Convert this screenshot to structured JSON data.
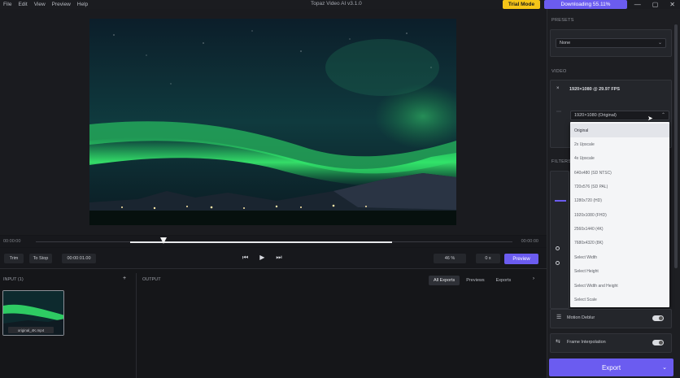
{
  "menu": {
    "items": [
      "File",
      "Edit",
      "View",
      "Preview",
      "Help"
    ]
  },
  "app_title": "Topaz Video AI v3.1.0",
  "trial_label": "Trial Mode",
  "download_label": "Downloading 55.11%",
  "window_controls": {
    "minimize": "—",
    "maximize": "▢",
    "close": "✕"
  },
  "timeline": {
    "start": "00:00:00",
    "end": "00:00:00",
    "progress_fill": 0.55
  },
  "controls": {
    "trim_label": "Trim",
    "step_label": "To Stop",
    "timecode": "00:00:01.00",
    "zoom_value": "46 %",
    "frame_value": "0 x",
    "preview_label": "Preview"
  },
  "input": {
    "label": "INPUT (1)",
    "add": "+",
    "file_name": "original_4K.mp4"
  },
  "output": {
    "label": "OUTPUT",
    "tabs": [
      "All Exports",
      "Previews",
      "Exports"
    ],
    "arrow": "›"
  },
  "right_panel": {
    "presets_label": "PRESETS",
    "preset_value": "None",
    "video_label": "VIDEO",
    "video_info": "1920×1080 @ 29.97 FPS",
    "resolution_select": "1920×1080 (Original)",
    "filters_label": "FILTERS",
    "motion_deblur": "Motion Deblur",
    "frame_interp": "Frame Interpolation",
    "export_label": "Export"
  },
  "dropdown_items": [
    "Original",
    "2x Upscale",
    "4x Upscale",
    "640x480 (SD NTSC)",
    "720x576 (SD PAL)",
    "1280x720 (HD)",
    "1920x1080 (FHD)",
    "2560x1440 (4K)",
    "7680x4320 (8K)",
    "Select Width",
    "Select Height",
    "Select Width and Height",
    "Select Scale"
  ],
  "colors": {
    "accent": "#6b5cf0",
    "trial": "#f5c518",
    "aurora": "#2fe86a"
  }
}
